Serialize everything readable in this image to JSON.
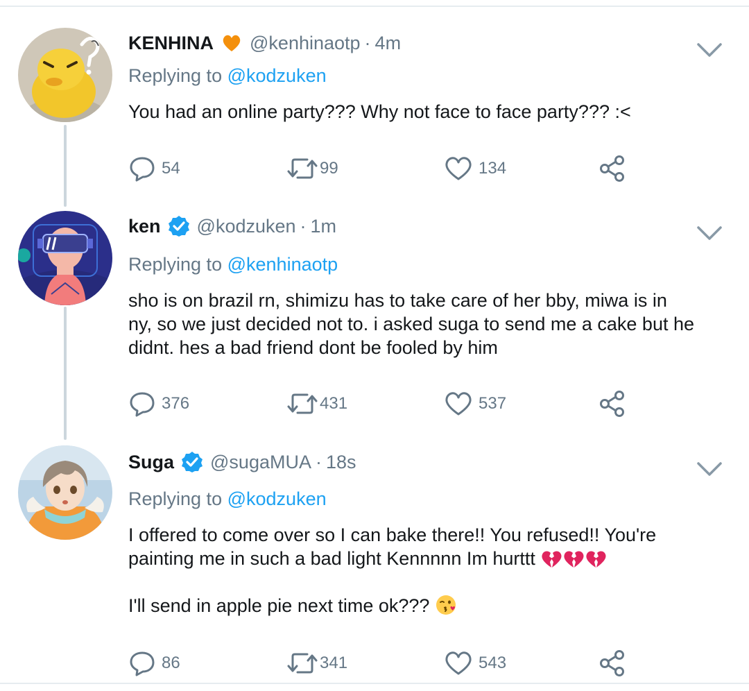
{
  "tweets": [
    {
      "name": "KENHINA",
      "name_emoji": "orange-heart",
      "verified": false,
      "handle": "@kenhinaotp",
      "separator": "·",
      "time": "4m",
      "replying_prefix": "Replying to",
      "replying_to": "@kodzuken",
      "text_lines": [
        "You had an online party??? Why not face to face party??? :<"
      ],
      "replies": "54",
      "retweets": "99",
      "likes": "134",
      "avatar": "yellow-duck-avatar"
    },
    {
      "name": "ken",
      "verified": true,
      "handle": "@kodzuken",
      "separator": "·",
      "time": "1m",
      "replying_prefix": "Replying to",
      "replying_to": "@kenhinaotp",
      "text_lines": [
        "sho is on brazil rn, shimizu has to take care of her bby, miwa is in",
        "ny, so we just decided not to. i asked suga to send me a cake but he",
        "didnt. hes a bad friend dont be fooled by him"
      ],
      "replies": "376",
      "retweets": "431",
      "likes": "537",
      "avatar": "gamer-headset-avatar"
    },
    {
      "name": "Suga",
      "verified": true,
      "handle": "@sugaMUA",
      "separator": "·",
      "time": "18s",
      "replying_prefix": "Replying to",
      "replying_to": "@kodzuken",
      "text_lines": [
        "I offered to come over so I can bake there!! You refused!! You're",
        "painting me in such a bad light Kennnnn Im hurttt"
      ],
      "text_line2_emojis": [
        "broken-heart",
        "broken-heart",
        "broken-heart"
      ],
      "text_after": "I'll send in apple pie next time ok???",
      "text_after_emoji": "face-blowing-kiss",
      "replies": "86",
      "retweets": "341",
      "likes": "543",
      "avatar": "anime-winter-avatar"
    }
  ],
  "colors": {
    "link": "#1da1f2",
    "muted": "#657786",
    "text": "#14171a",
    "thread_line": "#ccd6dd",
    "verified": "#1da1f2"
  }
}
